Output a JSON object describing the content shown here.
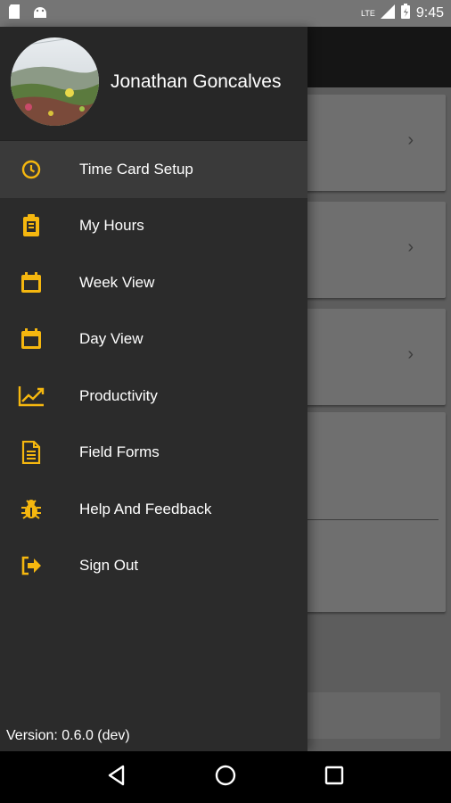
{
  "status_bar": {
    "network": "LTE",
    "time": "9:45"
  },
  "user": {
    "name": "Jonathan Goncalves"
  },
  "menu": {
    "items": [
      {
        "label": "Time Card Setup",
        "icon": "clock-icon",
        "active": true
      },
      {
        "label": "My Hours",
        "icon": "clipboard-icon"
      },
      {
        "label": "Week View",
        "icon": "calendar-icon"
      },
      {
        "label": "Day View",
        "icon": "calendar-icon"
      },
      {
        "label": "Productivity",
        "icon": "chart-trend-icon"
      },
      {
        "label": "Field Forms",
        "icon": "document-icon"
      },
      {
        "label": "Help And Feedback",
        "icon": "bug-icon"
      },
      {
        "label": "Sign Out",
        "icon": "sign-out-icon"
      }
    ]
  },
  "version": "Version: 0.6.0 (dev)",
  "colors": {
    "accent": "#F5B70F",
    "drawer_bg": "#2B2B2B",
    "active_item_bg": "#3A3A3A"
  }
}
